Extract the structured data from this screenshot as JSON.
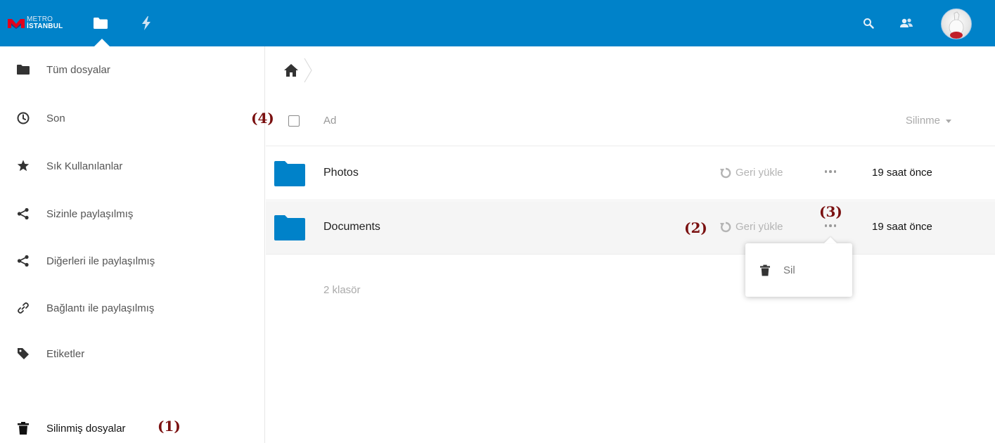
{
  "header": {
    "logo": {
      "line1": "METRO",
      "line2": "İSTANBUL",
      "brand_color": "#e3001b"
    },
    "apps": [
      {
        "name": "files",
        "icon": "folder-icon",
        "active": true
      },
      {
        "name": "activity",
        "icon": "lightning-icon",
        "active": false
      }
    ],
    "right_icons": [
      "search-icon",
      "contacts-icon"
    ],
    "bar_color": "#0082c9"
  },
  "sidebar": {
    "items": [
      {
        "label": "Tüm dosyalar",
        "icon": "folder-icon"
      },
      {
        "label": "Son",
        "icon": "clock-icon"
      },
      {
        "label": "Sık Kullanılanlar",
        "icon": "star-icon"
      },
      {
        "label": "Sizinle paylaşılmış",
        "icon": "share-icon"
      },
      {
        "label": "Diğerleri ile paylaşılmış",
        "icon": "share-icon"
      },
      {
        "label": "Bağlantı ile paylaşılmış",
        "icon": "link-icon"
      },
      {
        "label": "Etiketler",
        "icon": "tag-icon"
      },
      {
        "label": "Silinmiş dosyalar",
        "icon": "trash-icon",
        "active": true
      }
    ]
  },
  "main": {
    "breadcrumb": {
      "home_icon": "home-icon"
    },
    "table": {
      "name_header": "Ad",
      "date_header": "Silinme",
      "rows": [
        {
          "name": "Photos",
          "restore_label": "Geri yükle",
          "date": "19 saat önce"
        },
        {
          "name": "Documents",
          "restore_label": "Geri yükle",
          "date": "19 saat önce"
        }
      ],
      "summary": "2 klasör"
    },
    "menu": {
      "items": [
        {
          "label": "Sil",
          "icon": "trash-icon"
        }
      ]
    }
  },
  "callouts": {
    "c1": "(1)",
    "c2": "(2)",
    "c3": "(3)",
    "c4": "(4)"
  }
}
